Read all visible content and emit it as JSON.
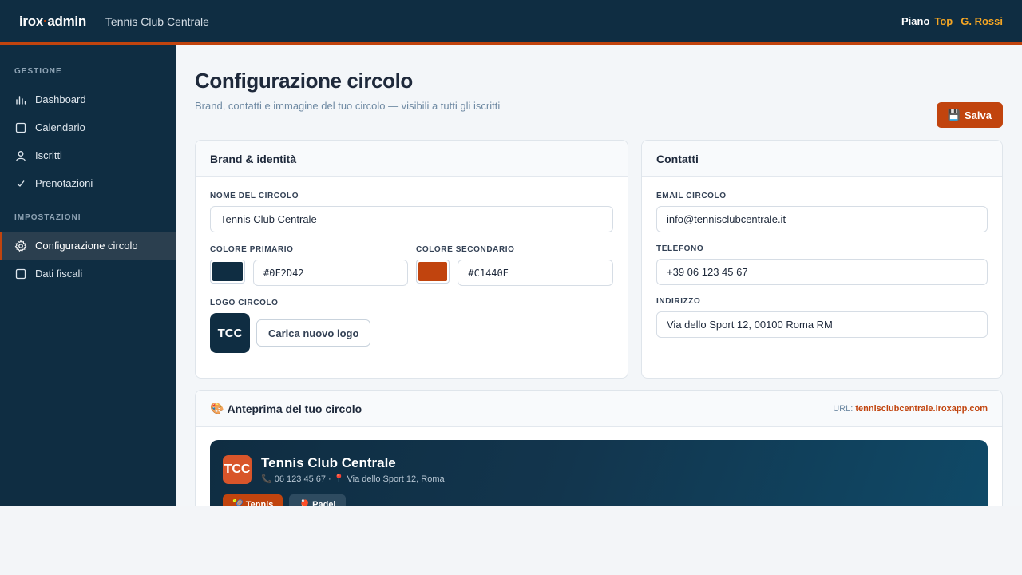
{
  "topbar": {
    "brand_left": "irox",
    "brand_dot": "·",
    "brand_right": "admin",
    "club_name": "Tennis Club Centrale",
    "plan_label": "Piano",
    "plan_tier": "Top",
    "user_name": "G. Rossi"
  },
  "sidebar": {
    "section_gestione": "GESTIONE",
    "section_impostazioni": "IMPOSTAZIONI",
    "items": [
      {
        "label": "Dashboard",
        "icon": "bar-chart-icon"
      },
      {
        "label": "Calendario",
        "icon": "calendar-icon"
      },
      {
        "label": "Iscritti",
        "icon": "user-icon"
      },
      {
        "label": "Prenotazioni",
        "icon": "check-icon"
      },
      {
        "label": "Configurazione circolo",
        "icon": "gear-icon",
        "active": true
      },
      {
        "label": "Dati fiscali",
        "icon": "document-icon"
      }
    ]
  },
  "page": {
    "title": "Configurazione circolo",
    "subtitle": "Brand, contatti e immagine del tuo circolo — visibili a tutti gli iscritti",
    "save_label": "Salva",
    "save_icon": "💾"
  },
  "brand_card": {
    "title": "Brand & identità",
    "name_label": "NOME DEL CIRCOLO",
    "name_value": "Tennis Club Centrale",
    "primary_label": "COLORE PRIMARIO",
    "primary_value": "#0F2D42",
    "secondary_label": "COLORE SECONDARIO",
    "secondary_value": "#C1440E",
    "logo_label": "LOGO CIRCOLO",
    "logo_initials": "TCC",
    "upload_label": "Carica nuovo logo"
  },
  "contacts_card": {
    "title": "Contatti",
    "email_label": "EMAIL CIRCOLO",
    "email_value": "info@tennisclubcentrale.it",
    "phone_label": "TELEFONO",
    "phone_value": "+39 06 123 45 67",
    "address_label": "INDIRIZZO",
    "address_value": "Via dello Sport 12, 00100 Roma RM"
  },
  "preview_card": {
    "icon": "🎨",
    "title": "Anteprima del tuo circolo",
    "url_label": "URL:",
    "url_value": "tennisclubcentrale.iroxapp.com",
    "banner_initials": "TCC",
    "banner_name": "Tennis Club Centrale",
    "banner_meta": "📞 06 123 45 67 · 📍 Via dello Sport 12, Roma",
    "chip_tennis": "🎾 Tennis",
    "chip_padel": "🏓 Padel"
  },
  "colors": {
    "primary": "#0F2D42",
    "secondary": "#C1440E"
  }
}
